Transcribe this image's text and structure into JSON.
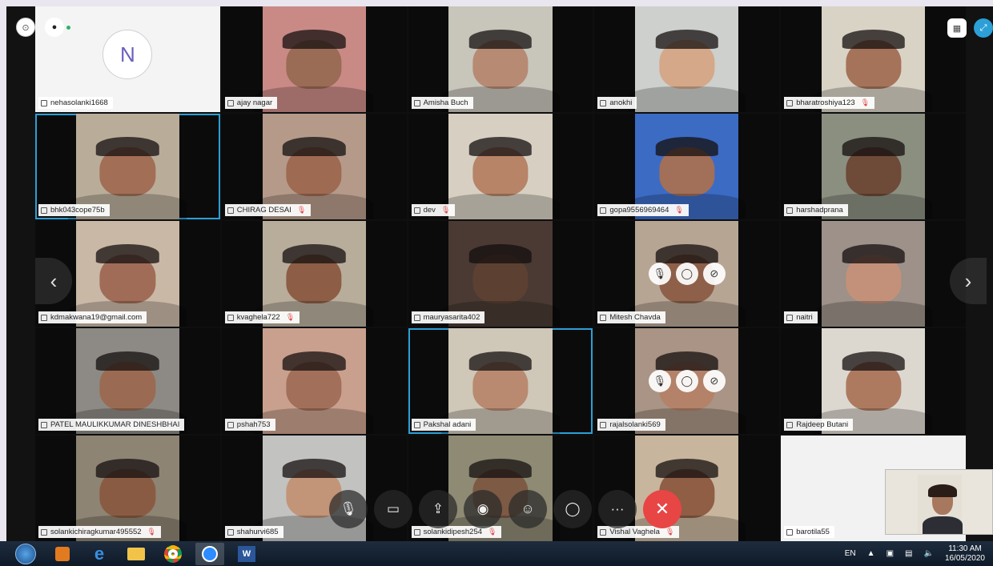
{
  "participants": [
    {
      "name": "nehasolanki1668",
      "avatar": "N",
      "video": false,
      "muted": false
    },
    {
      "name": "ajay nagar",
      "video": true,
      "muted": false,
      "bg": "#c98a86",
      "skin": "#9a6b55"
    },
    {
      "name": "Amisha Buch",
      "video": true,
      "muted": false,
      "bg": "#c8c5bb",
      "skin": "#b78a73"
    },
    {
      "name": "anokhi",
      "video": true,
      "muted": false,
      "bg": "#cdd0cc",
      "skin": "#d4a889"
    },
    {
      "name": "bharatroshiya123",
      "video": true,
      "muted": true,
      "bg": "#d9d3c6",
      "skin": "#a5735a"
    },
    {
      "name": "bhk043cope75b",
      "video": true,
      "muted": false,
      "bg": "#b9ad9a",
      "skin": "#a26e56",
      "active": true
    },
    {
      "name": "CHIRAG DESAI",
      "video": true,
      "muted": true,
      "bg": "#b59a8a",
      "skin": "#9f6a52"
    },
    {
      "name": "dev",
      "video": true,
      "muted": true,
      "bg": "#d7d0c2",
      "skin": "#b78468"
    },
    {
      "name": "gopa9556969464",
      "video": true,
      "muted": true,
      "bg": "#3c6bc4",
      "skin": "#a26f59"
    },
    {
      "name": "harshadprana",
      "video": true,
      "muted": false,
      "bg": "#8b8f80",
      "skin": "#6e4a38"
    },
    {
      "name": "kdmakwana19@gmail.com",
      "video": true,
      "muted": false,
      "bg": "#c9b8a6",
      "skin": "#a06c57"
    },
    {
      "name": "kvaghela722",
      "video": true,
      "muted": true,
      "bg": "#b8ad9b",
      "skin": "#8d5d45"
    },
    {
      "name": "mauryasarita402",
      "video": true,
      "muted": false,
      "bg": "#4a3a33",
      "skin": "#5c4031"
    },
    {
      "name": "Mitesh Chavda",
      "video": true,
      "muted": false,
      "bg": "#b7a594",
      "skin": "#8e6049",
      "hover": true
    },
    {
      "name": "naitri",
      "video": true,
      "muted": false,
      "bg": "#9d9189",
      "skin": "#c39179"
    },
    {
      "name": "PATEL MAULIKKUMAR DINESHBHAI",
      "video": true,
      "muted": false,
      "bg": "#8d8a85",
      "skin": "#9a6b52"
    },
    {
      "name": "pshah753",
      "video": true,
      "muted": false,
      "bg": "#c9a08e",
      "skin": "#a2705a"
    },
    {
      "name": "Pakshal adani",
      "video": true,
      "muted": false,
      "bg": "#cfc7b8",
      "skin": "#b98a70",
      "active": true
    },
    {
      "name": "rajalsolanki569",
      "video": true,
      "muted": false,
      "bg": "#a99485",
      "skin": "#b38268",
      "hover": true
    },
    {
      "name": "Rajdeep Butani",
      "video": true,
      "muted": false,
      "bg": "#ddd8cf",
      "skin": "#ad7a60"
    },
    {
      "name": "solankichiragkumar495552",
      "video": true,
      "muted": true,
      "bg": "#8e8473",
      "skin": "#8a5b43"
    },
    {
      "name": "shahurvi685",
      "video": true,
      "muted": false,
      "bg": "#c2c2c0",
      "skin": "#c29478"
    },
    {
      "name": "solankidipesh254",
      "video": true,
      "muted": true,
      "bg": "#8f8a74",
      "skin": "#7d5a44"
    },
    {
      "name": "Vishal Vaghela",
      "video": true,
      "muted": true,
      "bg": "#c8b59d",
      "skin": "#8f5e45"
    },
    {
      "name": "barotila55",
      "video": false,
      "muted": false,
      "bg": "#f2f2f2"
    }
  ],
  "toolbar": {
    "buttons": [
      {
        "name": "mic-off-button",
        "icon": "🎙"
      },
      {
        "name": "camera-off-button",
        "icon": "▭"
      },
      {
        "name": "share-screen-button",
        "icon": "⇪"
      },
      {
        "name": "record-button",
        "icon": "◉"
      },
      {
        "name": "participants-button",
        "icon": "☺"
      },
      {
        "name": "chat-button",
        "icon": "◯"
      },
      {
        "name": "more-options-button",
        "icon": "···"
      },
      {
        "name": "end-call-button",
        "icon": "✕"
      }
    ]
  },
  "tray": {
    "language": "EN",
    "time": "11:30 AM",
    "date": "16/05/2020"
  },
  "colors": {
    "accent": "#2c9fd6",
    "end_call": "#e84545",
    "taskbar": "#1d2c3e"
  }
}
